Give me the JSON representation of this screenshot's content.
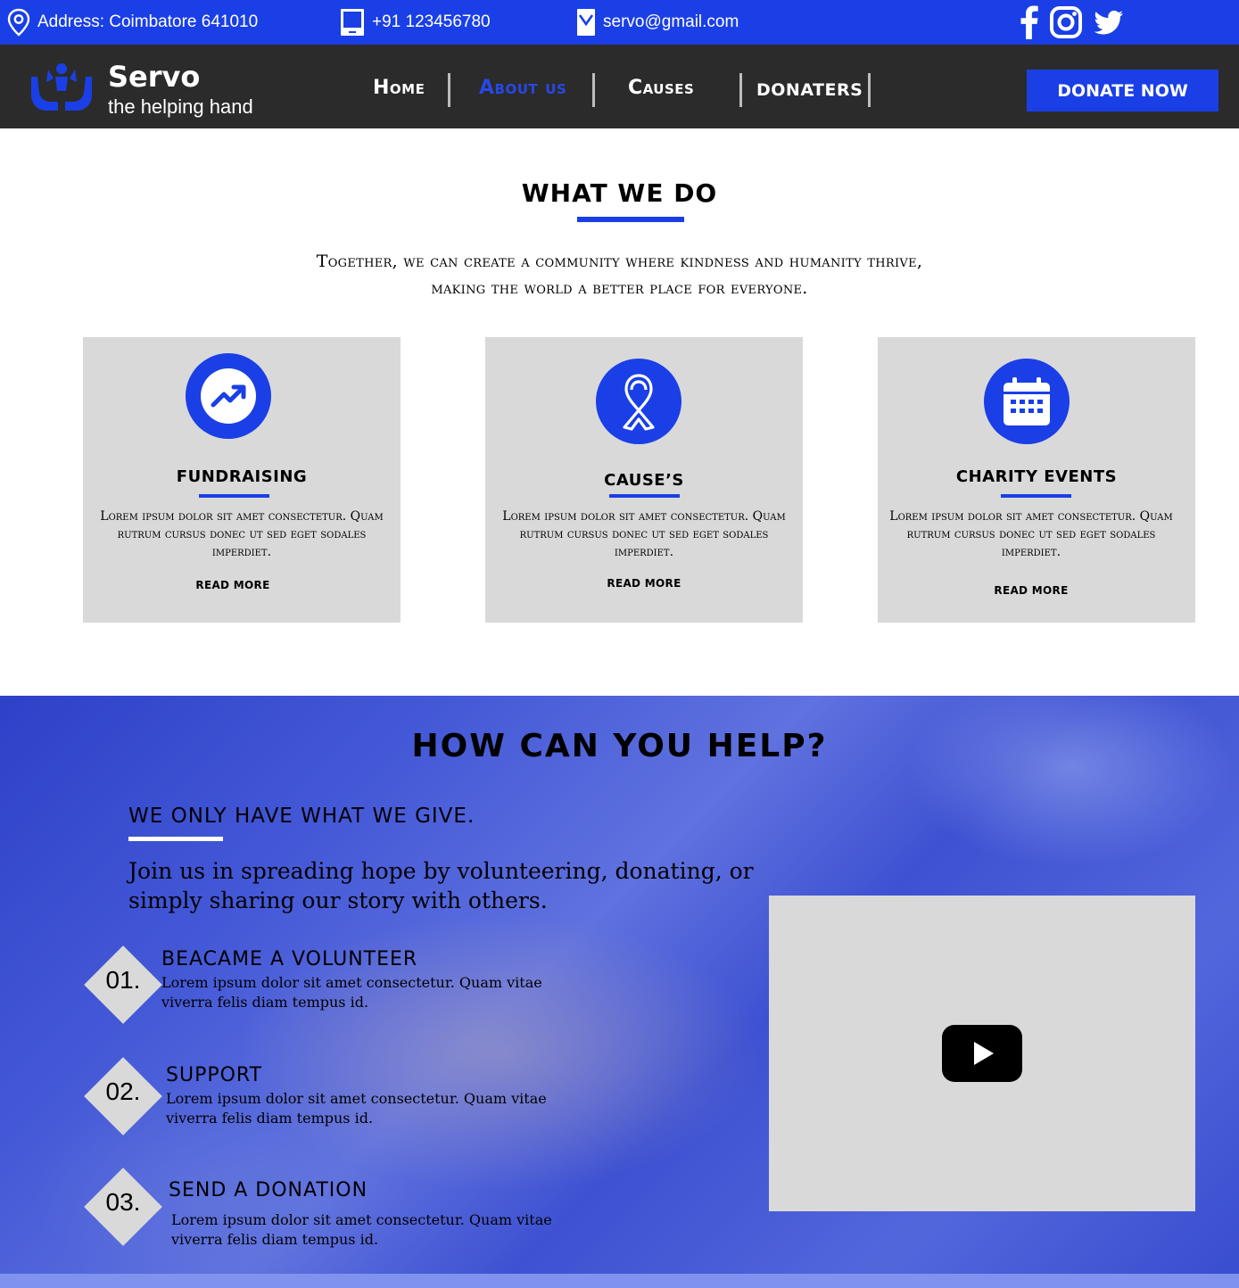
{
  "topbar": {
    "address": "Address: Coimbatore 641010",
    "phone": "+91 123456780",
    "email": "servo@gmail.com",
    "social": [
      "facebook-icon",
      "instagram-icon",
      "twitter-icon"
    ]
  },
  "nav": {
    "brand": "Servo",
    "tagline": "the helping hand",
    "links": [
      "Home",
      "About us",
      "Causes",
      "DONATERS"
    ],
    "active": "About us",
    "donate_label": "DONATE NOW"
  },
  "what_we_do": {
    "title": "WHAT WE DO",
    "subtitle_line1": "Together, we can create a community where kindness and humanity thrive,",
    "subtitle_line2": "making the world a better place for everyone.",
    "cards": [
      {
        "icon": "trending-up-icon",
        "title": "FUNDRAISING",
        "text": "Lorem ipsum dolor sit amet consectetur. Quam rutrum cursus donec ut sed eget sodales imperdiet.",
        "more": "READ MORE"
      },
      {
        "icon": "ribbon-icon",
        "title": "CAUSE’S",
        "text": "Lorem ipsum dolor sit amet consectetur. Quam rutrum cursus donec ut sed eget sodales imperdiet.",
        "more": "READ MORE"
      },
      {
        "icon": "calendar-icon",
        "title": "CHARITY EVENTS",
        "text": "Lorem ipsum dolor sit amet consectetur. Quam rutrum cursus donec ut sed eget sodales imperdiet.",
        "more": "READ MORE"
      }
    ]
  },
  "help": {
    "title": "HOW CAN YOU HELP?",
    "subtitle": "WE ONLY HAVE WHAT WE GIVE.",
    "paragraph": "Join us in spreading hope by volunteering, donating, or simply sharing our story with others.",
    "steps": [
      {
        "num": "01.",
        "title": "BEACAME A VOLUNTEER",
        "text": "Lorem ipsum dolor sit amet consectetur. Quam vitae viverra felis diam tempus id."
      },
      {
        "num": "02.",
        "title": "SUPPORT",
        "text": "Lorem ipsum dolor sit amet consectetur. Quam vitae viverra felis diam tempus id."
      },
      {
        "num": "03.",
        "title": "SEND A DONATION",
        "text": "Lorem ipsum dolor sit amet consectetur. Quam vitae viverra felis diam tempus id."
      }
    ],
    "video_icon": "youtube-play-icon"
  },
  "colors": {
    "primary": "#1a3fe6",
    "dark": "#2b2b2b",
    "card": "#d9d9d9"
  }
}
